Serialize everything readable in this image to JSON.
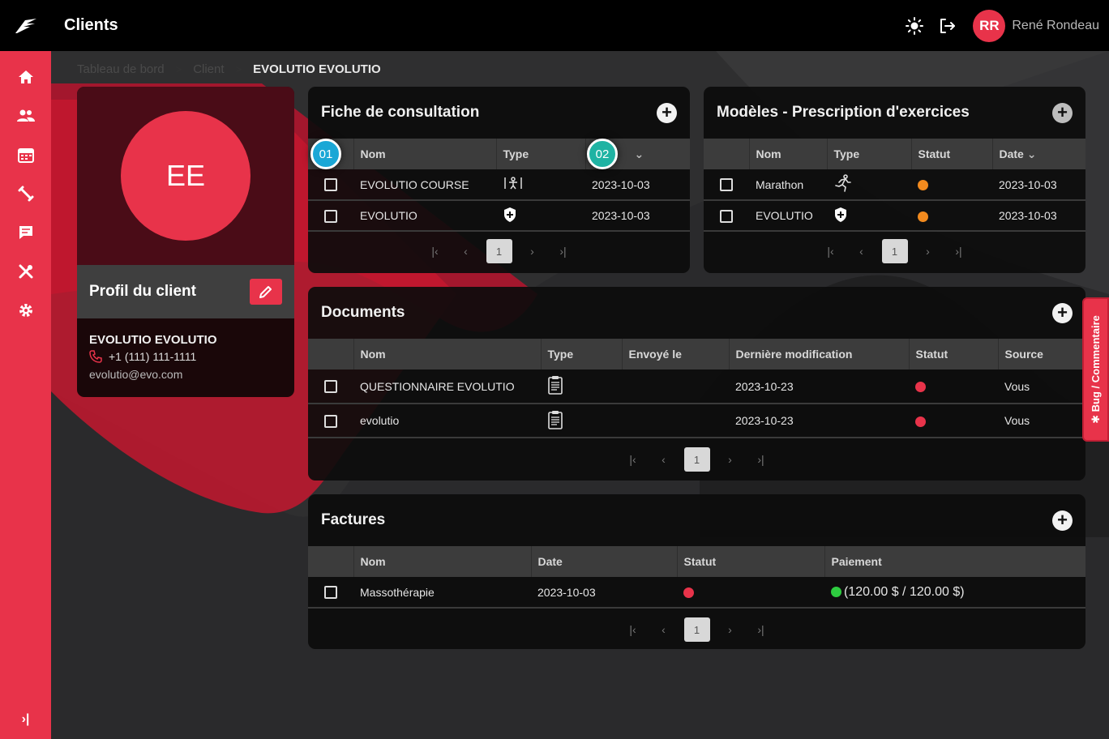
{
  "header": {
    "title": "Clients",
    "user_initials": "RR",
    "user_name": "René Rondeau"
  },
  "breadcrumb": {
    "items": [
      "Tableau de bord",
      "Client"
    ],
    "current": "EVOLUTIO EVOLUTIO",
    "separator": ">"
  },
  "profile": {
    "initials": "EE",
    "section_label": "Profil du client",
    "name": "EVOLUTIO EVOLUTIO",
    "phone": "+1 (111) 111-1111",
    "email": "evolutio@evo.com"
  },
  "steps": {
    "one": "01",
    "two": "02"
  },
  "consultation": {
    "title": "Fiche de consultation",
    "col_nom": "Nom",
    "col_type": "Type",
    "rows": [
      {
        "nom": "EVOLUTIO COURSE",
        "type_icon": "body-scan-icon",
        "date": "2023-10-03"
      },
      {
        "nom": "EVOLUTIO",
        "type_icon": "shield-icon",
        "date": "2023-10-03"
      }
    ],
    "page": "1"
  },
  "modeles": {
    "title": "Modèles - Prescription d'exercices",
    "col_nom": "Nom",
    "col_type": "Type",
    "col_statut": "Statut",
    "col_date": "Date",
    "rows": [
      {
        "nom": "Marathon",
        "type_icon": "runner-icon",
        "statut_color": "#f28a1e",
        "date": "2023-10-03"
      },
      {
        "nom": "EVOLUTIO",
        "type_icon": "shield-icon",
        "statut_color": "#f28a1e",
        "date": "2023-10-03"
      }
    ],
    "page": "1"
  },
  "documents": {
    "title": "Documents",
    "col_nom": "Nom",
    "col_type": "Type",
    "col_envoye": "Envoyé le",
    "col_modif": "Dernière modification",
    "col_statut": "Statut",
    "col_source": "Source",
    "rows": [
      {
        "nom": "QUESTIONNAIRE EVOLUTIO",
        "type_icon": "clipboard-icon",
        "envoye": "",
        "modif": "2023-10-23",
        "statut_color": "#e8334a",
        "source": "Vous"
      },
      {
        "nom": "evolutio",
        "type_icon": "clipboard-icon",
        "envoye": "",
        "modif": "2023-10-23",
        "statut_color": "#e8334a",
        "source": "Vous"
      }
    ],
    "page": "1"
  },
  "factures": {
    "title": "Factures",
    "col_nom": "Nom",
    "col_date": "Date",
    "col_statut": "Statut",
    "col_paiement": "Paiement",
    "rows": [
      {
        "nom": "Massothérapie",
        "date": "2023-10-03",
        "statut_color": "#e8334a",
        "paiement_color": "#2ecc40",
        "paiement": "(120.00 $ / 120.00 $)"
      }
    ],
    "page": "1"
  },
  "bug_tab": {
    "label": "Bug / Commentaire"
  },
  "colors": {
    "accent": "#e8334a",
    "warning": "#f28a1e",
    "success": "#2ecc40"
  }
}
